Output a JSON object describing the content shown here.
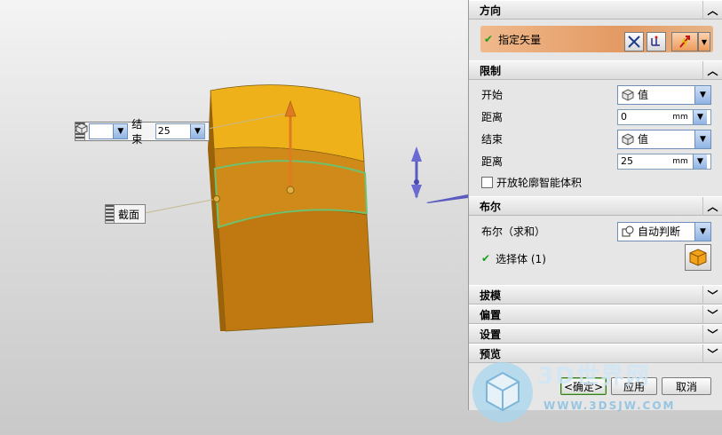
{
  "callouts": {
    "end": {
      "label": "结束",
      "value": "25",
      "arrow": "▼"
    },
    "section": {
      "label": "截面"
    }
  },
  "dialog": {
    "direction": {
      "title": "方向",
      "toggle": "︿",
      "specify_vector": "指定矢量",
      "check": "✔"
    },
    "limits": {
      "title": "限制",
      "toggle": "︿",
      "start_label": "开始",
      "start_option": "值",
      "start_distance_label": "距离",
      "start_distance_value": "0",
      "end_label": "结束",
      "end_option": "值",
      "end_distance_label": "距离",
      "end_distance_value": "25",
      "unit": "mm",
      "open_profile_label": "开放轮廓智能体积",
      "open_profile_checked": false
    },
    "boolean": {
      "title": "布尔",
      "toggle": "︿",
      "boolean_label": "布尔（求和）",
      "boolean_option": "自动判断",
      "select_body_label": "选择体 (1)",
      "check": "✔"
    },
    "draft": {
      "title": "拔模",
      "toggle": "﹀"
    },
    "offset": {
      "title": "偏置",
      "toggle": "﹀"
    },
    "settings": {
      "title": "设置",
      "toggle": "﹀"
    },
    "preview": {
      "title": "预览",
      "toggle": "﹀"
    },
    "buttons": {
      "ok": "<确定>",
      "apply": "应用",
      "cancel": "取消"
    }
  },
  "watermark": {
    "brand": "3D世界网",
    "url": "WWW.3DSJW.COM"
  },
  "colors": {
    "accent_orange": "#e8a46c",
    "body_orange": "#d88f17",
    "arrow_blue": "#6060c8"
  }
}
